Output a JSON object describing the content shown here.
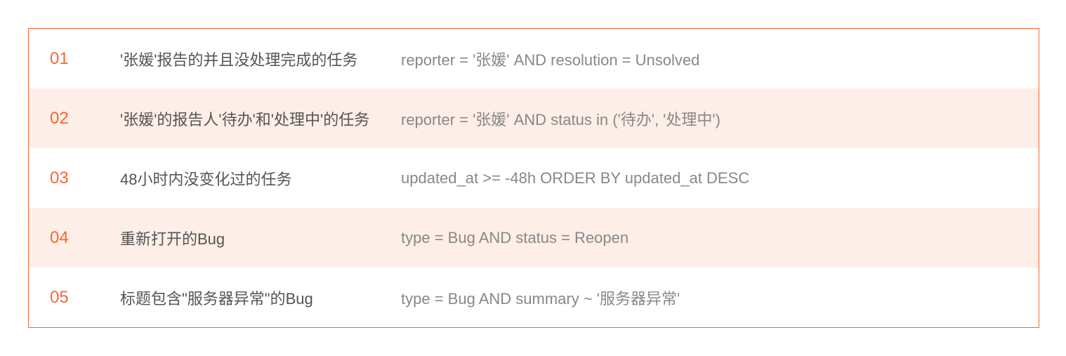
{
  "rows": [
    {
      "number": "01",
      "description": "'张媛'报告的并且没处理完成的任务",
      "query": "reporter = '张媛' AND resolution = Unsolved"
    },
    {
      "number": "02",
      "description": "'张媛'的报告人'待办'和'处理中'的任务",
      "query": "reporter = '张媛' AND status in ('待办', '处理中')"
    },
    {
      "number": "03",
      "description": "48小时内没变化过的任务",
      "query": "updated_at >= -48h ORDER BY updated_at DESC"
    },
    {
      "number": "04",
      "description": "重新打开的Bug",
      "query": "type = Bug AND status = Reopen"
    },
    {
      "number": "05",
      "description": "标题包含\"服务器异常\"的Bug",
      "query": "type = Bug AND summary ~ '服务器异常'"
    }
  ]
}
